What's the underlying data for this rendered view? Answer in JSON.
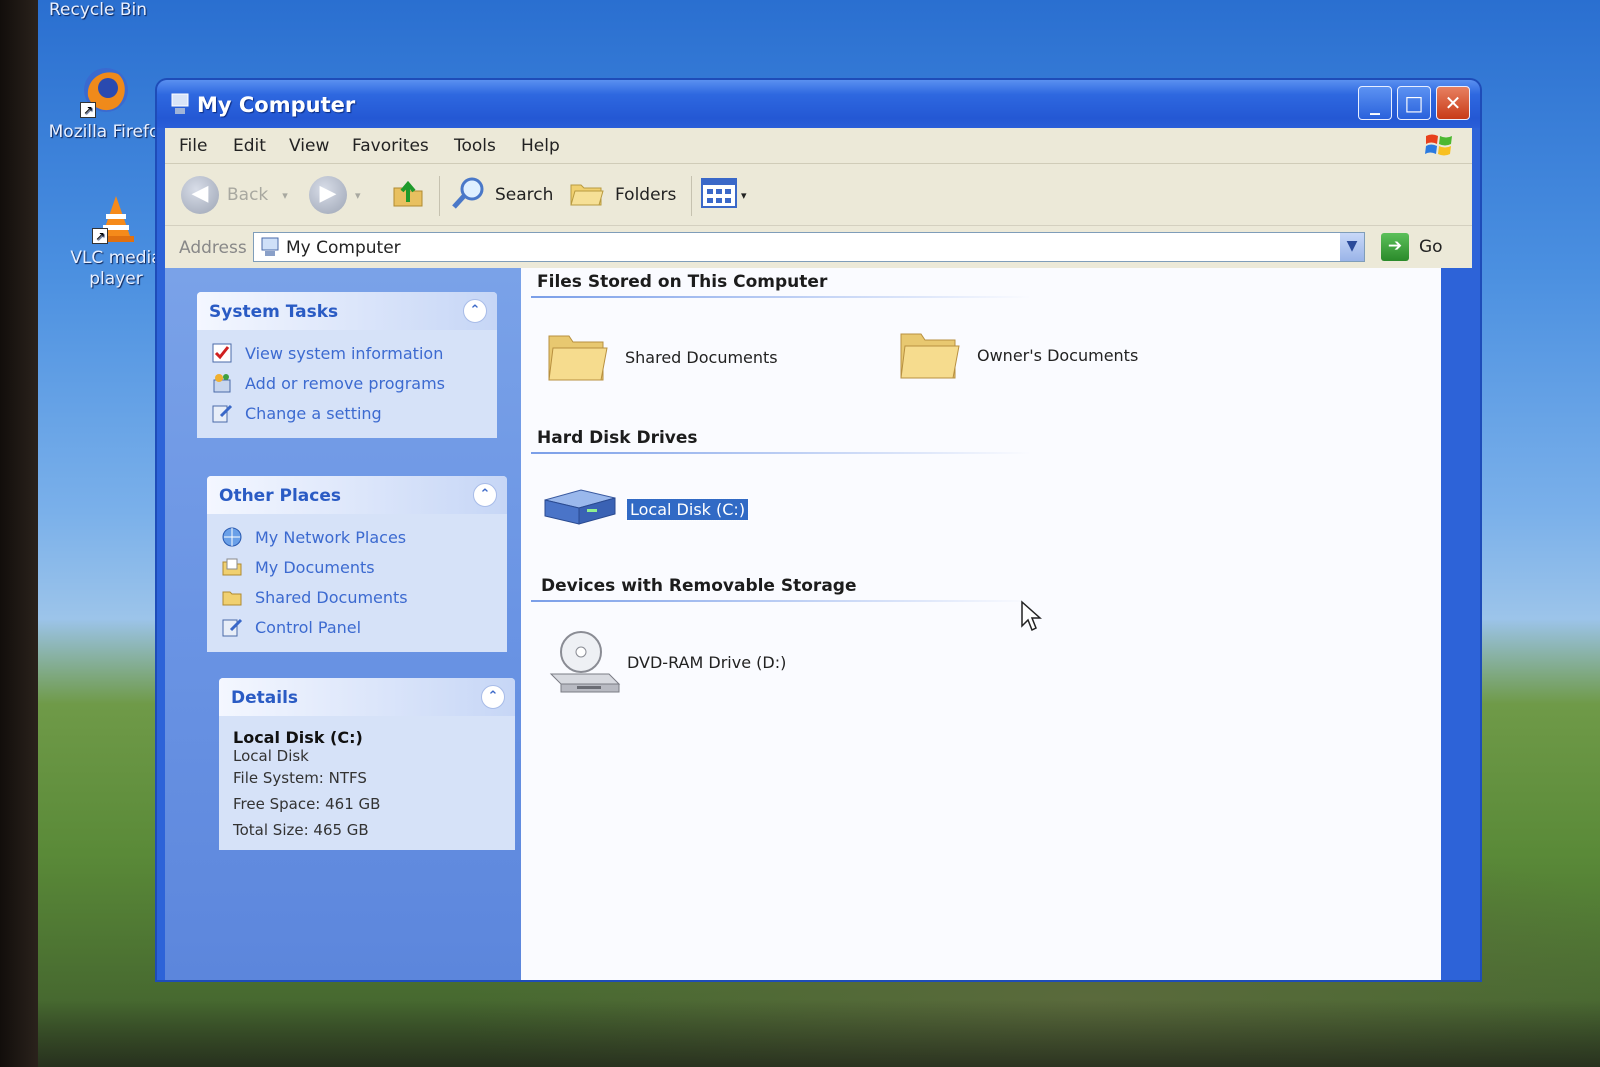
{
  "desktop": {
    "icons": [
      {
        "label": "Recycle Bin",
        "icon": "recycle-bin-icon"
      },
      {
        "label": "Mozilla Firefo",
        "icon": "firefox-icon"
      },
      {
        "label": "VLC media player",
        "icon": "vlc-icon"
      }
    ]
  },
  "window": {
    "title": "My Computer",
    "controls": {
      "minimize": "_",
      "maximize": "□",
      "close": "✕"
    }
  },
  "menu": {
    "items": [
      "File",
      "Edit",
      "View",
      "Favorites",
      "Tools",
      "Help"
    ]
  },
  "toolbar": {
    "back": "Back",
    "search": "Search",
    "folders": "Folders"
  },
  "address": {
    "label": "Address",
    "value": "My Computer",
    "go": "Go"
  },
  "taskpane": {
    "system_tasks": {
      "title": "System Tasks",
      "links": [
        "View system information",
        "Add or remove programs",
        "Change a setting"
      ]
    },
    "other_places": {
      "title": "Other Places",
      "links": [
        "My Network Places",
        "My Documents",
        "Shared Documents",
        "Control Panel"
      ]
    },
    "details": {
      "title": "Details",
      "name": "Local Disk (C:)",
      "type": "Local Disk",
      "file_system": "File System: NTFS",
      "free_space": "Free Space: 461 GB",
      "total_size": "Total Size: 465 GB"
    }
  },
  "content": {
    "groups": [
      {
        "title": "Files Stored on This Computer",
        "items": [
          "Shared Documents",
          "Owner's Documents"
        ]
      },
      {
        "title": "Hard Disk Drives",
        "items": [
          "Local Disk (C:)"
        ]
      },
      {
        "title": "Devices with Removable Storage",
        "items": [
          "DVD-RAM Drive (D:)"
        ]
      }
    ],
    "selected_item": "Local Disk (C:)"
  },
  "colors": {
    "titlebar": "#2458d4",
    "taskpane": "#6a94e4",
    "link": "#3c6ad0",
    "selection": "#316ac5"
  }
}
